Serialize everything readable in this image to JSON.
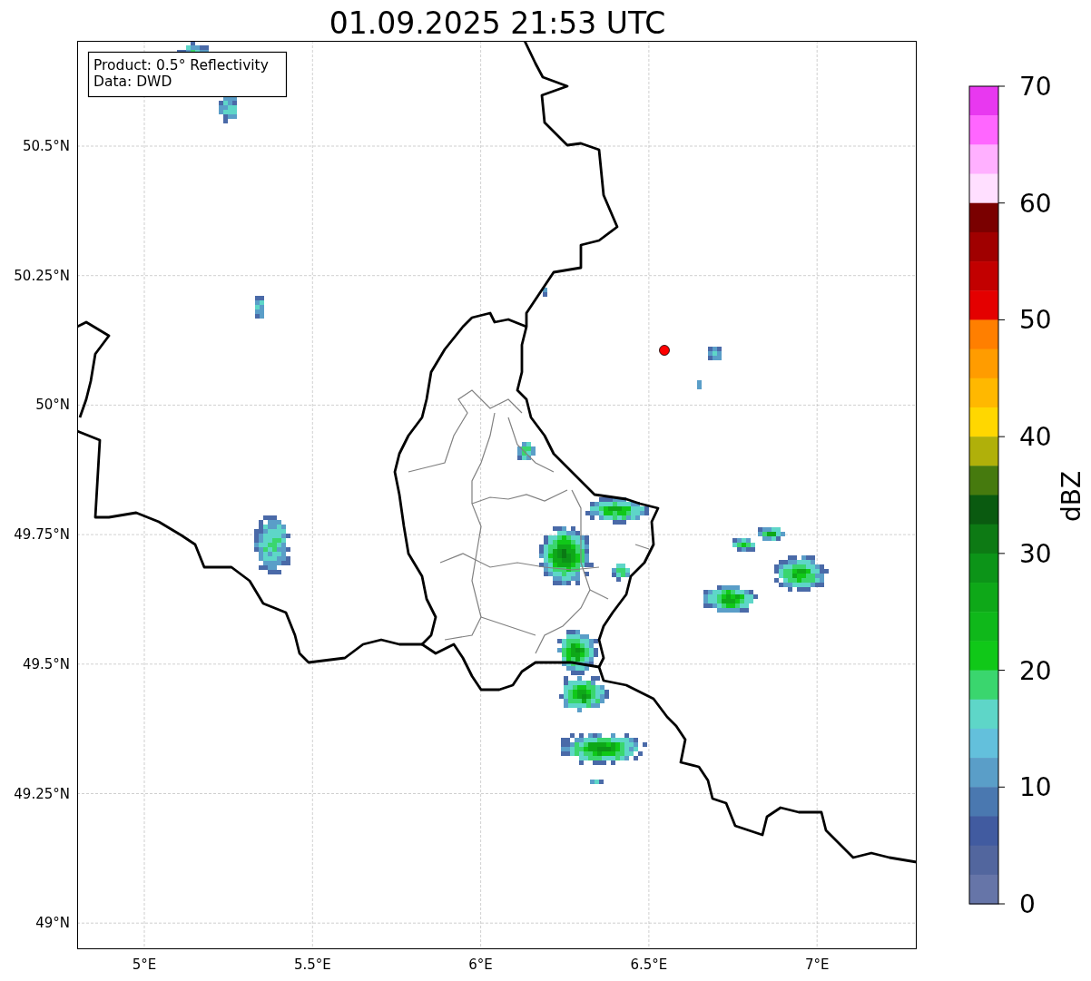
{
  "title": "01.09.2025 21:53 UTC",
  "map": {
    "info_box": {
      "lines": [
        "Product: 0.5° Reflectivity",
        "Data: DWD"
      ]
    },
    "lat_labels": [
      "50.5°N",
      "50.25°N",
      "50°N",
      "49.75°N",
      "49.5°N",
      "49.25°N",
      "49°N"
    ],
    "lon_labels": [
      "5°E",
      "5.5°E",
      "6°E",
      "6.5°E",
      "7°E"
    ]
  },
  "colorbar": {
    "label": "dBZ",
    "ticks": [
      "70",
      "60",
      "50",
      "40",
      "30",
      "20",
      "10",
      "0"
    ],
    "bins": [
      {
        "color": "#e838f0"
      },
      {
        "color": "#ff66ff"
      },
      {
        "color": "#ffb0ff"
      },
      {
        "color": "#ffdfff"
      },
      {
        "color": "#7a0000"
      },
      {
        "color": "#a00000"
      },
      {
        "color": "#c20000"
      },
      {
        "color": "#e40000"
      },
      {
        "color": "#ff7f00"
      },
      {
        "color": "#ff9c00"
      },
      {
        "color": "#ffb800"
      },
      {
        "color": "#ffd700"
      },
      {
        "color": "#b0b00a"
      },
      {
        "color": "#467a0e"
      },
      {
        "color": "#0a5a10"
      },
      {
        "color": "#0d7a14"
      },
      {
        "color": "#0c9418"
      },
      {
        "color": "#0ea818"
      },
      {
        "color": "#0fb81a"
      },
      {
        "color": "#10c818"
      },
      {
        "color": "#3ad66e"
      },
      {
        "color": "#5ed6c8"
      },
      {
        "color": "#63c0dc"
      },
      {
        "color": "#5a9ec8"
      },
      {
        "color": "#4a78b0"
      },
      {
        "color": "#415ba0"
      },
      {
        "color": "#52669e"
      },
      {
        "color": "#6675a8"
      }
    ]
  }
}
